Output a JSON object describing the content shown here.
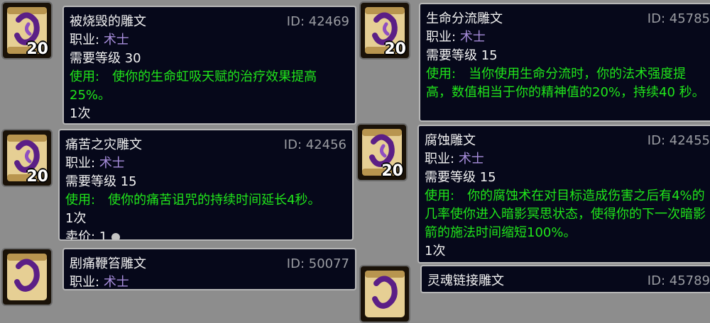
{
  "glyphs": [
    {
      "name": "被烧毁的雕文",
      "id": "ID: 42469",
      "class_label": "职业:",
      "class_value": "术士",
      "level_label": "需要等级",
      "level_value": "30",
      "use_label": "使用:",
      "use_text": "使你的生命虹吸天赋的治疗效果提高25%。",
      "charges": "1次",
      "price": "",
      "stack": "20",
      "icon": "purple-scroll-icon"
    },
    {
      "name": "生命分流雕文",
      "id": "ID: 45785",
      "class_label": "职业:",
      "class_value": "术士",
      "level_label": "需要等级",
      "level_value": "15",
      "use_label": "使用:",
      "use_text": "当你使用生命分流时，你的法术强度提高，数值相当于你的精神值的20%，持续40 秒。",
      "charges": "",
      "price": "",
      "stack": "20",
      "icon": "purple-scroll-icon"
    },
    {
      "name": "痛苦之灾雕文",
      "id": "ID: 42456",
      "class_label": "职业:",
      "class_value": "术士",
      "level_label": "需要等级",
      "level_value": "15",
      "use_label": "使用:",
      "use_text": "使你的痛苦诅咒的持续时间延长4秒。",
      "charges": "1次",
      "price": "卖价: 1",
      "stack": "20",
      "icon": "purple-scroll-icon"
    },
    {
      "name": "腐蚀雕文",
      "id": "ID: 42455",
      "class_label": "职业:",
      "class_value": "术士",
      "level_label": "需要等级",
      "level_value": "15",
      "use_label": "使用:",
      "use_text": "你的腐蚀术在对目标造成伤害之后有4%的几率使你进入暗影冥思状态，使得你的下一次暗影箭的施法时间缩短100%。",
      "charges": "1次",
      "price": "",
      "stack": "20",
      "icon": "purple-scroll-icon"
    },
    {
      "name": "剧痛鞭笞雕文",
      "id": "ID: 50077",
      "class_label": "职业:",
      "class_value": "术士",
      "level_label": "",
      "level_value": "",
      "use_label": "",
      "use_text": "",
      "charges": "",
      "price": "",
      "stack": "",
      "icon": "purple-scroll-icon"
    },
    {
      "name": "灵魂链接雕文",
      "id": "ID: 45789",
      "class_label": "",
      "class_value": "",
      "level_label": "",
      "level_value": "",
      "use_label": "",
      "use_text": "",
      "charges": "",
      "price": "",
      "stack": "",
      "icon": "purple-scroll-icon"
    }
  ]
}
